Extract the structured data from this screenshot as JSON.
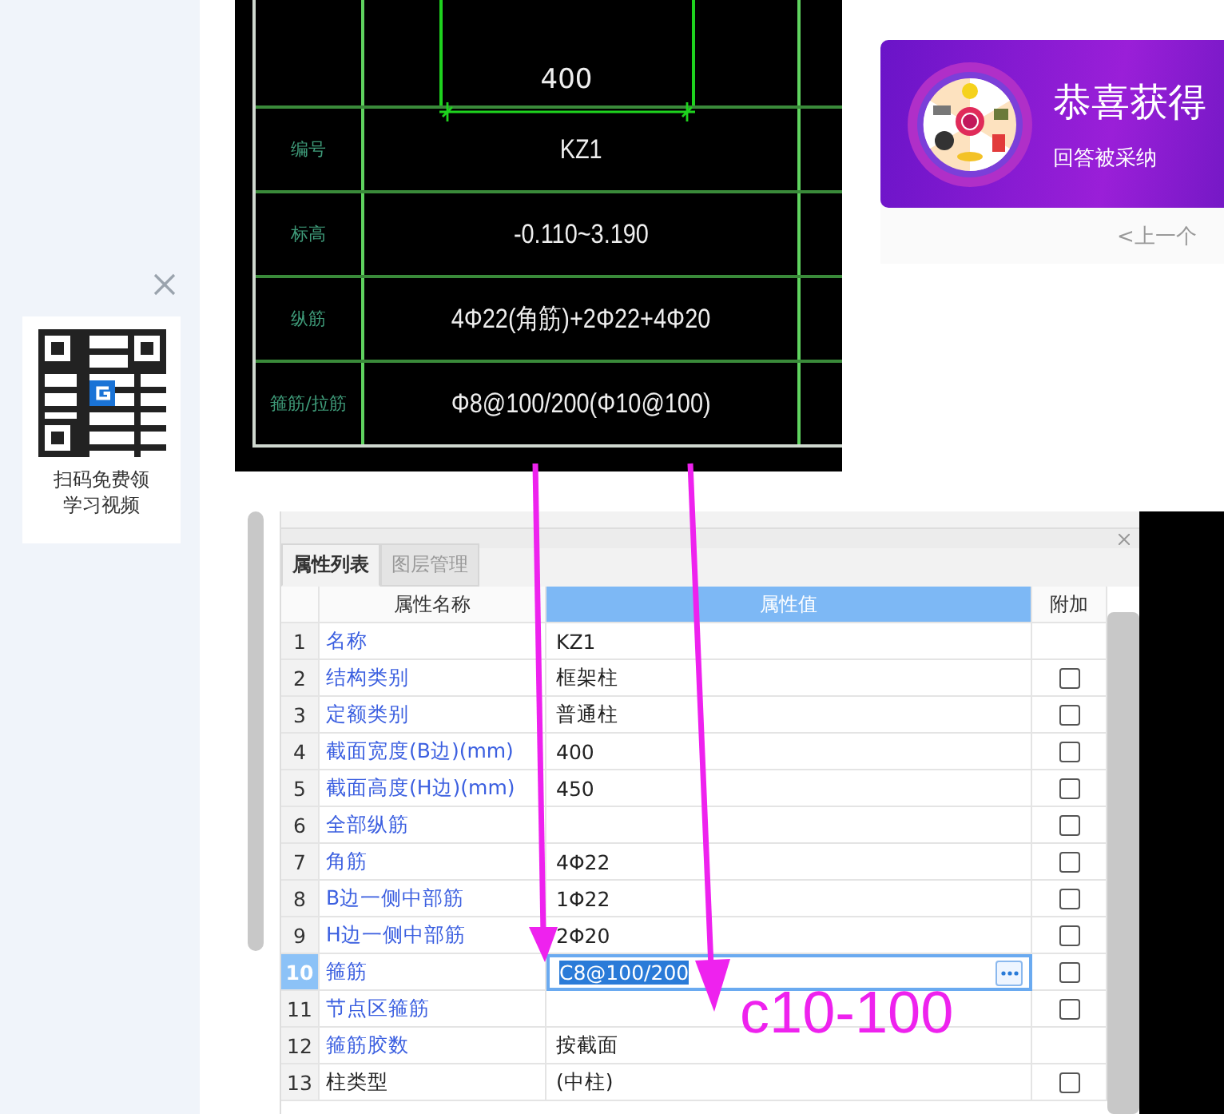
{
  "qr_ad": {
    "caption": [
      "扫码免费领",
      "学习视频"
    ]
  },
  "drawing": {
    "dimension": "400",
    "rows": [
      {
        "label": "编号",
        "value": "KZ1"
      },
      {
        "label": "标高",
        "value": "-0.110~3.190"
      },
      {
        "label": "纵筋",
        "value": "4Φ22(角筋)+2Φ22+4Φ20"
      },
      {
        "label": "箍筋/拉筋",
        "value": "Φ8@100/200(Φ10@100)"
      }
    ]
  },
  "promo": {
    "title": "恭喜获得",
    "subtitle": "回答被采纳",
    "nav": "<上一个"
  },
  "panel": {
    "tabs": [
      {
        "label": "属性列表",
        "selected": true
      },
      {
        "label": "图层管理",
        "selected": false
      }
    ],
    "columns": [
      "属性名称",
      "属性值",
      "附加"
    ],
    "rows": [
      {
        "index": "1",
        "name": "名称",
        "value": "KZ1",
        "public": true,
        "selected": false
      },
      {
        "index": "2",
        "name": "结构类别",
        "value": "框架柱",
        "public": true,
        "checkbox": {
          "checked": false
        },
        "selected": false
      },
      {
        "index": "3",
        "name": "定额类别",
        "value": "普通柱",
        "public": true,
        "checkbox": {
          "checked": false
        },
        "selected": false
      },
      {
        "index": "4",
        "name": "截面宽度(B边)(mm)",
        "value": "400",
        "public": true,
        "checkbox": {
          "checked": false
        },
        "selected": false
      },
      {
        "index": "5",
        "name": "截面高度(H边)(mm)",
        "value": "450",
        "public": true,
        "checkbox": {
          "checked": false
        },
        "selected": false
      },
      {
        "index": "6",
        "name": "全部纵筋",
        "public": true,
        "checkbox": {
          "checked": false
        },
        "selected": false
      },
      {
        "index": "7",
        "name": "角筋",
        "value": "4Φ22",
        "public": true,
        "checkbox": {
          "checked": false
        },
        "selected": false
      },
      {
        "index": "8",
        "name": "B边一侧中部筋",
        "value": "1Φ22",
        "public": true,
        "checkbox": {
          "checked": false
        },
        "selected": false
      },
      {
        "index": "9",
        "name": "H边一侧中部筋",
        "value": "2Φ20",
        "public": true,
        "checkbox": {
          "checked": false
        },
        "selected": false
      },
      {
        "index": "10",
        "name": "箍筋",
        "value": "C8@100/200",
        "public": true,
        "checkbox": {
          "checked": false
        },
        "selected": true
      },
      {
        "index": "11",
        "name": "节点区箍筋",
        "public": true,
        "checkbox": {
          "checked": false
        },
        "selected": false
      },
      {
        "index": "12",
        "name": "箍筋胶数",
        "value": "按截面",
        "public": true,
        "selected": false
      },
      {
        "index": "13",
        "name": "柱类型",
        "value": "(中柱)",
        "public": false,
        "checkbox": {
          "checked": false
        },
        "selected": false
      }
    ]
  },
  "annotation": {
    "text": "c10-100"
  }
}
